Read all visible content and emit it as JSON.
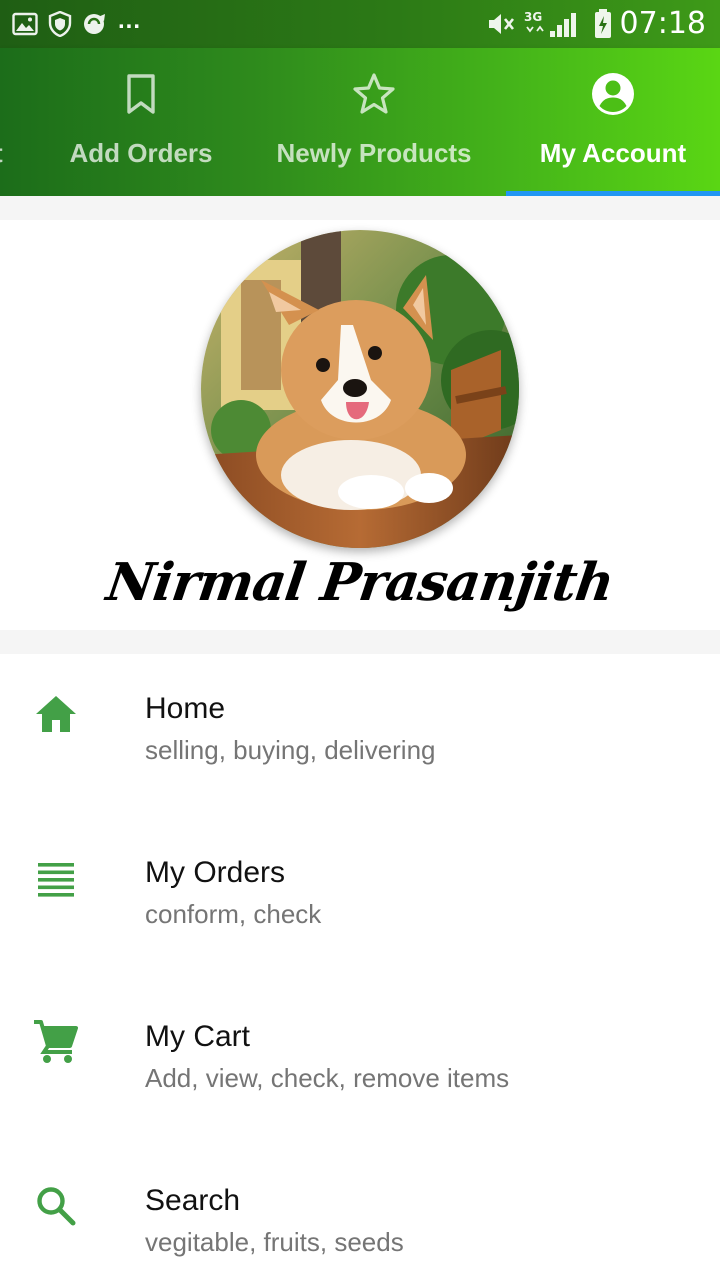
{
  "status_bar": {
    "overflow_dots": "...",
    "time": "07:18",
    "network_type": "3G",
    "icons": [
      "gallery-icon",
      "shield-icon",
      "sync-icon",
      "mute-icon",
      "signal-icon",
      "battery-charging-icon"
    ]
  },
  "tabs": [
    {
      "label": "t",
      "icon": "partial-tab"
    },
    {
      "label": "Add Orders",
      "icon": "bookmark-icon"
    },
    {
      "label": "Newly Products",
      "icon": "star-icon"
    },
    {
      "label": "My Account",
      "icon": "account-circle-icon",
      "active": true
    }
  ],
  "profile": {
    "name": "Nirmal Prasanjith",
    "avatar": "corgi-puppy-photo"
  },
  "menu": [
    {
      "title": "Home",
      "subtitle": "selling, buying, delivering",
      "icon": "home-icon"
    },
    {
      "title": "My Orders",
      "subtitle": "conform, check",
      "icon": "list-icon"
    },
    {
      "title": "My Cart",
      "subtitle": "Add, view, check, remove items",
      "icon": "cart-icon"
    },
    {
      "title": "Search",
      "subtitle": "vegitable, fruits, seeds",
      "icon": "search-icon"
    }
  ],
  "colors": {
    "accent_green": "#43a047",
    "tab_indicator": "#2196f3",
    "subtitle_gray": "#757575"
  }
}
